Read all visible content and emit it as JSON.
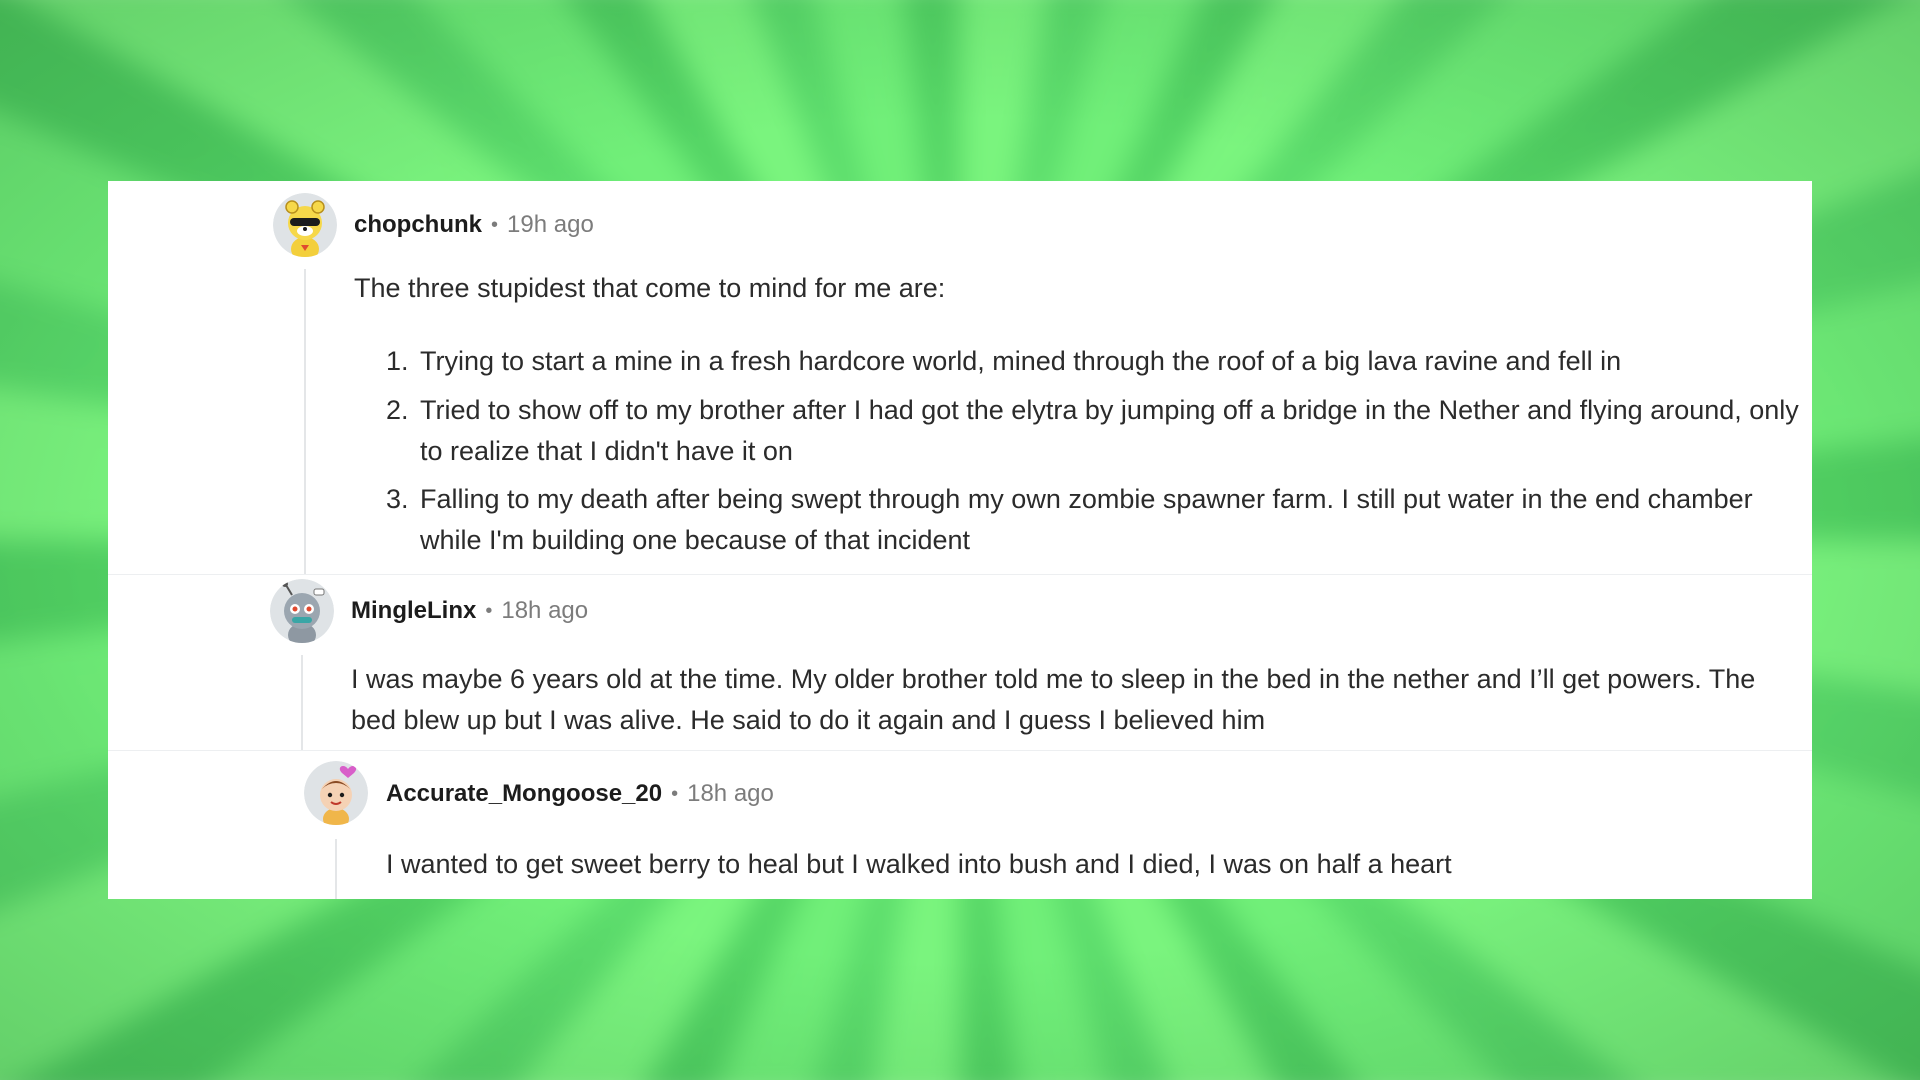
{
  "comments": [
    {
      "username": "chopchunk",
      "separator": "•",
      "time": "19h ago",
      "intro": "The three stupidest that come to mind for me are:",
      "list": [
        {
          "num": "1.",
          "text": "Trying to start a mine in a fresh hardcore world, mined through the roof of a big lava ravine and fell in"
        },
        {
          "num": "2.",
          "text": "Tried to show off to my brother after I had got the elytra by jumping off a bridge in the Nether and flying around, only to realize that I didn't have it on"
        },
        {
          "num": "3.",
          "text": "Falling to my death after being swept through my own zombie spawner farm. I still put water in the end chamber while I'm building one because of that incident"
        }
      ],
      "avatar_icon": "yellow-bear-snoo-avatar-icon"
    },
    {
      "username": "MingleLinx",
      "separator": "•",
      "time": "18h ago",
      "text": "I was maybe 6 years old at the time. My older brother told me to sleep in the bed in the nether and I’ll get powers. The bed blew up but I was alive. He said to do it again and I guess I believed him",
      "avatar_icon": "robot-snoo-avatar-icon"
    },
    {
      "username": "Accurate_Mongoose_20",
      "separator": "•",
      "time": "18h ago",
      "text": "I wanted to get sweet berry to heal but I walked into bush and I died, I was on half a heart",
      "avatar_icon": "heart-snoo-avatar-icon"
    }
  ],
  "colors": {
    "background": "#6fee79",
    "card": "#ffffff",
    "username": "#1c1c1c",
    "meta": "#7c7c7c",
    "body": "#2b2b2b",
    "thread_line": "#e4e6e8",
    "divider": "#edeff1"
  }
}
